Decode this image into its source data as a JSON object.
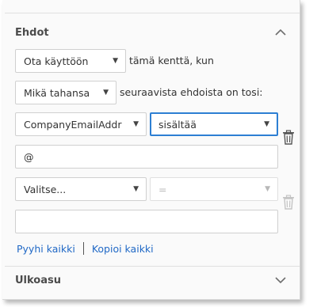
{
  "conditions": {
    "title": "Ehdot",
    "action_select": "Ota käyttöön",
    "action_text": "tämä kenttä, kun",
    "match_select": "Mikä tahansa",
    "match_text": "seuraavista ehdoista on tosi:",
    "rows": [
      {
        "field": "CompanyEmailAddr",
        "operator": "sisältää",
        "value": "@"
      },
      {
        "field": "Valitse...",
        "operator": "=",
        "value": ""
      }
    ],
    "clear_all": "Pyyhi kaikki",
    "copy_all": "Kopioi kaikki"
  },
  "appearance": {
    "title": "Ulkoasu"
  },
  "colors": {
    "focus": "#2d7fd3",
    "link": "#2169c6"
  }
}
